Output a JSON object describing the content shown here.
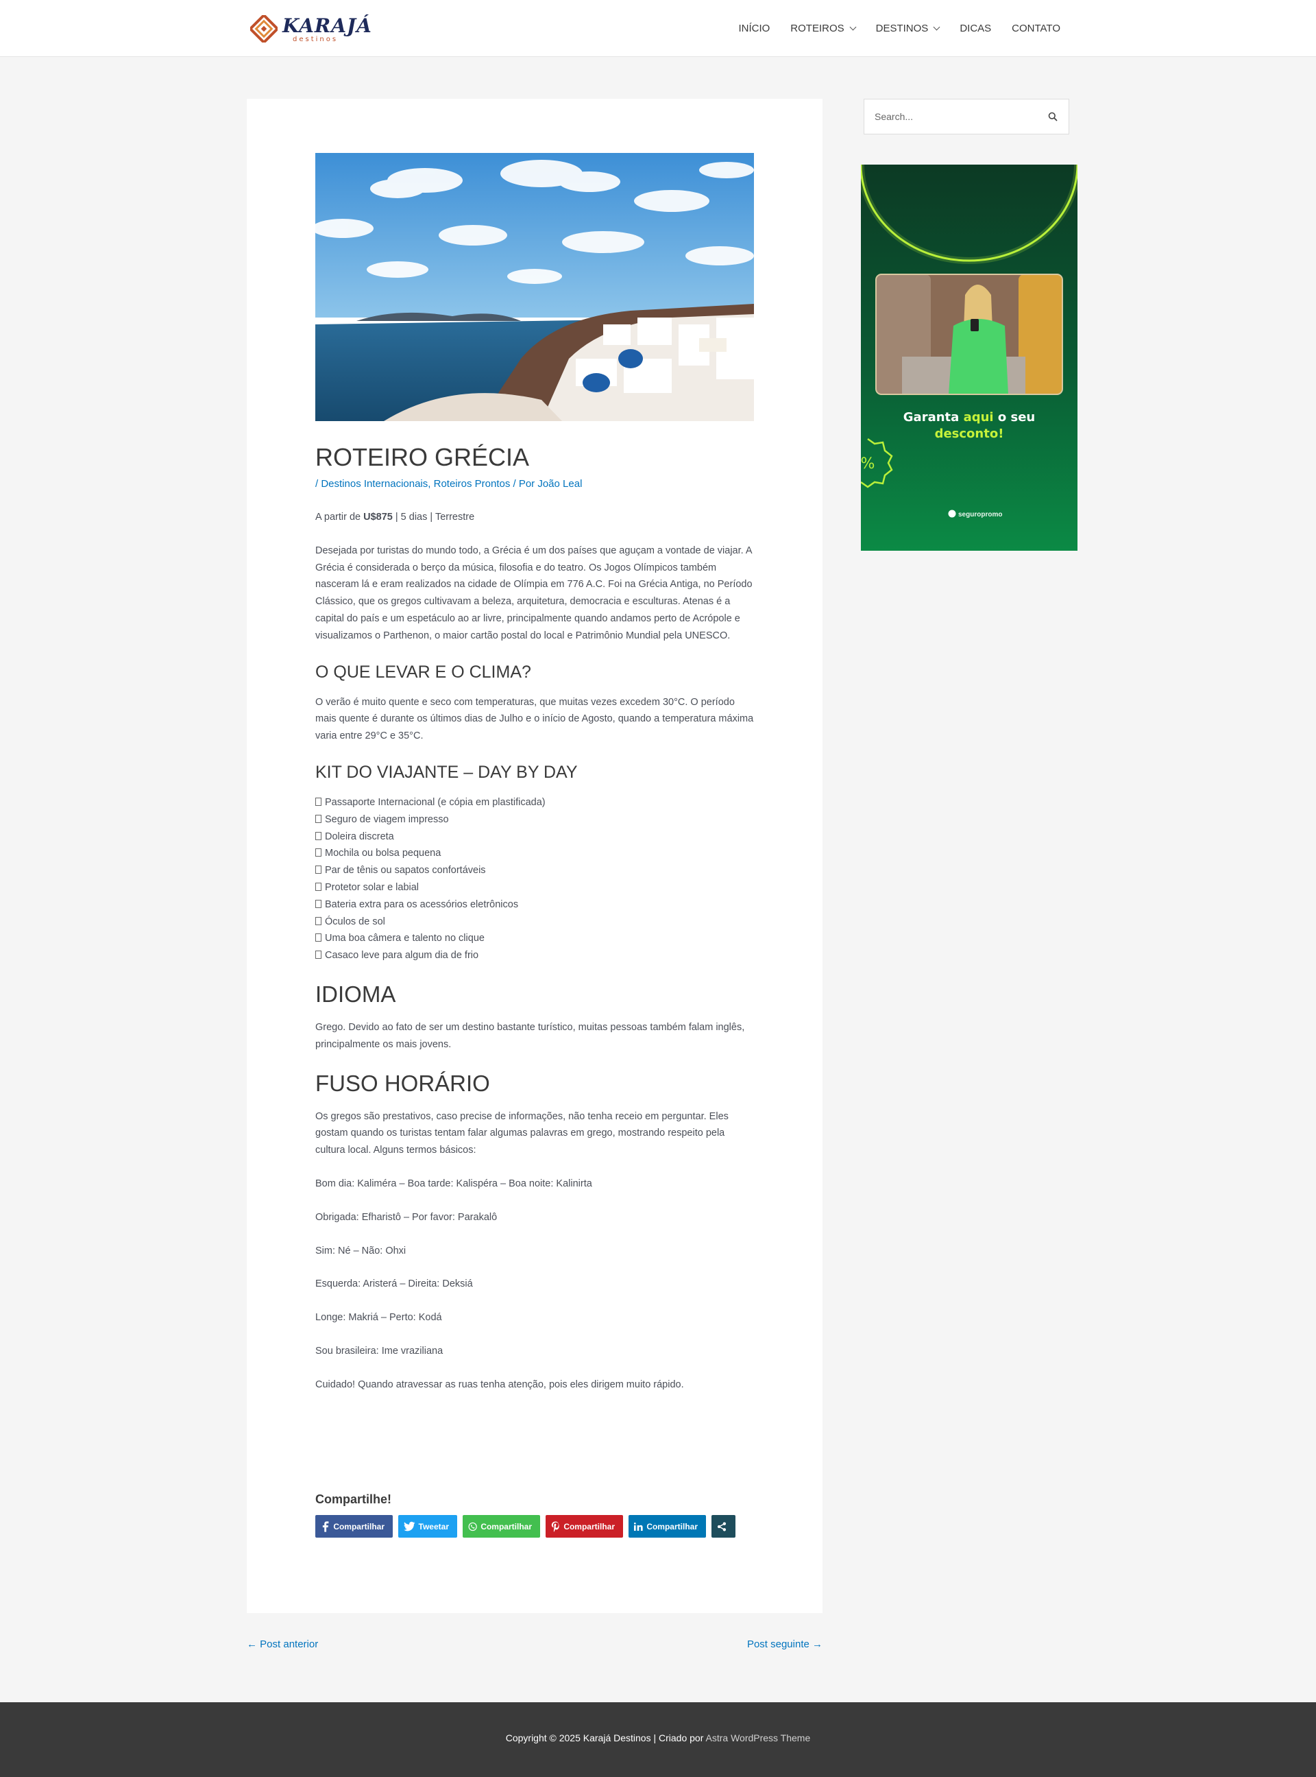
{
  "header": {
    "logo_text": "KARAJÁ",
    "logo_sub": "destinos",
    "nav": [
      {
        "label": "INÍCIO"
      },
      {
        "label": "ROTEIROS"
      },
      {
        "label": "DESTINOS"
      },
      {
        "label": "DICAS"
      },
      {
        "label": "CONTATO"
      }
    ]
  },
  "article": {
    "title": "ROTEIRO GRÉCIA",
    "meta": {
      "prefix": "/ ",
      "cat1": "Destinos Internacionais",
      "sep": ", ",
      "cat2": "Roteiros Prontos",
      "by": " / Por ",
      "author": "João Leal"
    },
    "price": {
      "prefix": "A partir de ",
      "value": "U$875",
      "rest": " | 5 dias | Terrestre"
    },
    "intro": "Desejada por turistas do mundo todo, a Grécia é um dos países que aguçam a vontade de viajar. A Grécia é considerada o berço da música, filosofia e do teatro. Os Jogos Olímpicos também nasceram lá e eram realizados na cidade de Olímpia em 776 A.C. Foi na Grécia Antiga, no Período Clássico, que os gregos cultivavam a beleza, arquitetura, democracia e esculturas. Atenas é a capital do país e um espetáculo ao ar livre, principalmente quando andamos perto de Acrópole e visualizamos o Parthenon, o maior cartão postal do local e Patrimônio Mundial pela UNESCO.",
    "h_clima": "O QUE LEVAR E O CLIMA?",
    "clima": "O verão é muito quente e seco com temperaturas, que muitas vezes excedem 30°C. O período mais quente é durante os últimos dias de Julho e o início de Agosto, quando a temperatura máxima varia entre 29°C e 35°C.",
    "h_kit": "KIT DO VIAJANTE – DAY BY DAY",
    "kit": [
      "Passaporte Internacional (e cópia em plastificada)",
      "Seguro de viagem impresso",
      "Doleira discreta",
      "Mochila ou bolsa pequena",
      "Par de tênis ou sapatos confortáveis",
      "Protetor solar e labial",
      "Bateria extra para os acessórios eletrônicos",
      "Óculos de sol",
      "Uma boa câmera e talento no clique",
      "Casaco leve para algum dia de frio"
    ],
    "h_idioma": "IDIOMA",
    "idioma": "Grego. Devido ao fato de ser um destino bastante turístico, muitas pessoas também falam inglês, principalmente os mais jovens.",
    "h_fuso": "FUSO HORÁRIO",
    "fuso": "Os gregos são prestativos, caso precise de informações, não tenha receio em perguntar. Eles gostam quando os turistas tentam falar algumas palavras em grego, mostrando respeito pela cultura local. Alguns termos básicos:",
    "terms": [
      "Bom dia: Kaliméra – Boa tarde: Kalispéra – Boa noite: Kalinirta",
      "Obrigada: Efharistô  – Por favor: Parakalô",
      "Sim: Né – Não: Ohxi",
      "Esquerda: Aristerá  – Direita: Deksiá",
      "Longe: Makriá – Perto: Kodá",
      "Sou brasileira: Ime vraziliana",
      "Cuidado! Quando atravessar as ruas tenha atenção, pois eles dirigem muito rápido."
    ]
  },
  "share": {
    "title": "Compartilhe!",
    "facebook": "Compartilhar",
    "twitter": "Tweetar",
    "whatsapp": "Compartilhar",
    "pinterest": "Compartilhar",
    "linkedin": "Compartilhar",
    "colors": {
      "facebook": "#3b5998",
      "twitter": "#1da1f2",
      "whatsapp": "#43bf4f",
      "pinterest": "#cb2027",
      "linkedin": "#0077b5",
      "more": "#1e4d5c"
    }
  },
  "post_nav": {
    "prev": "← Post anterior",
    "next": "Post seguinte →"
  },
  "sidebar": {
    "search_placeholder": "Search...",
    "ad": {
      "line1_a": "Garanta ",
      "line1_hl": "aqui",
      "line1_b": " o seu",
      "line2": "desconto!",
      "brand": "seguropromo"
    }
  },
  "footer": {
    "copyright": "Copyright © 2025 Karajá Destinos | Criado por ",
    "theme": "Astra WordPress Theme"
  },
  "colors": {
    "link": "#0274be",
    "footer_bg": "#3a3a3a",
    "page_bg": "#f5f5f5"
  }
}
